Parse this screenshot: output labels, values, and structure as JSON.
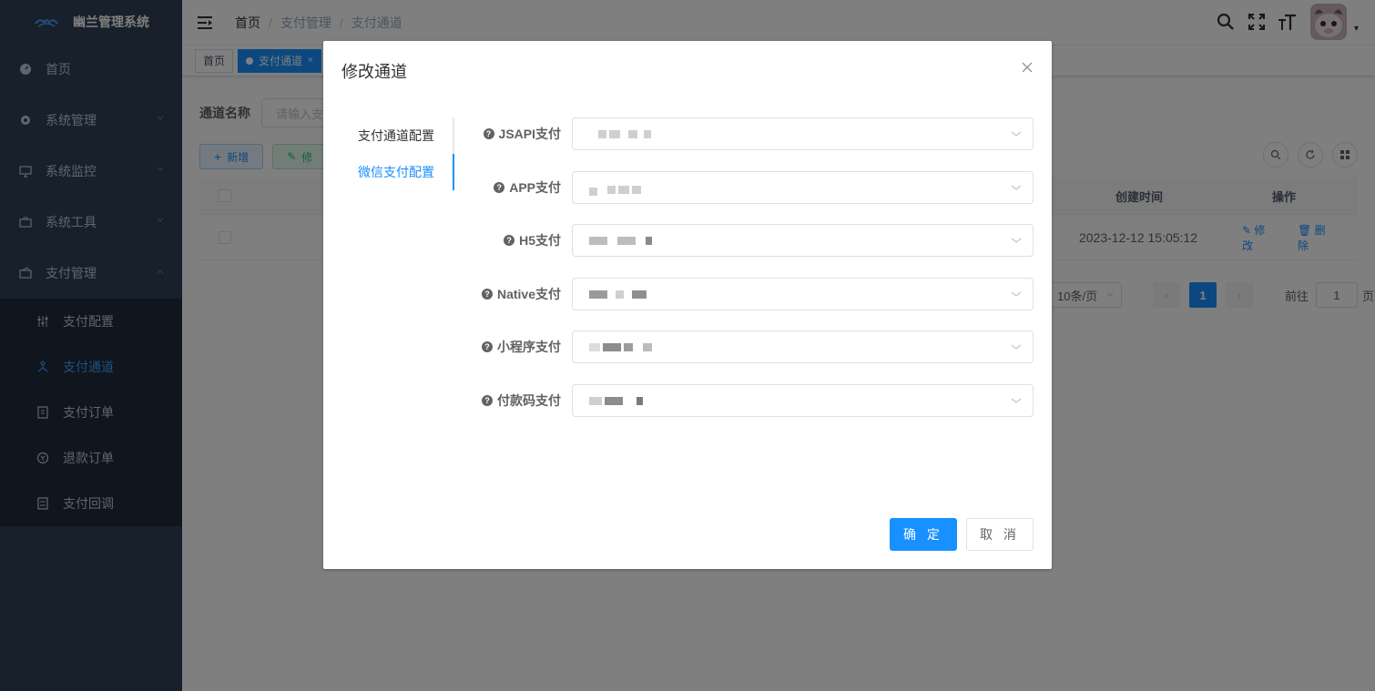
{
  "app": {
    "title": "幽兰管理系统"
  },
  "sidebar": {
    "items": [
      {
        "label": "首页",
        "icon": "dashboard-icon"
      },
      {
        "label": "系统管理",
        "icon": "gear-icon"
      },
      {
        "label": "系统监控",
        "icon": "monitor-icon"
      },
      {
        "label": "系统工具",
        "icon": "toolbox-icon"
      },
      {
        "label": "支付管理",
        "icon": "wallet-icon"
      }
    ],
    "sub_items": [
      {
        "label": "支付配置",
        "icon": "sliders-icon"
      },
      {
        "label": "支付通道",
        "icon": "channel-icon"
      },
      {
        "label": "支付订单",
        "icon": "order-icon"
      },
      {
        "label": "退款订单",
        "icon": "refund-icon"
      },
      {
        "label": "支付回调",
        "icon": "callback-icon"
      }
    ]
  },
  "navbar": {
    "breadcrumb": [
      "首页",
      "支付管理",
      "支付通道"
    ]
  },
  "tags": {
    "home": "首页",
    "current": "支付通道"
  },
  "search": {
    "label": "通道名称",
    "placeholder": "请输入支"
  },
  "toolbar": {
    "add_label": "新增",
    "edit_label": "修"
  },
  "table": {
    "headers": {
      "created": "创建时间",
      "ops": "操作"
    },
    "rows": [
      {
        "created": "2023-12-12 15:05:12",
        "edit": "修改",
        "delete": "删除"
      }
    ]
  },
  "pagination": {
    "page_size": "10条/页",
    "current_page": "1",
    "goto_label": "前往",
    "goto_value": "1",
    "page_suffix": "页"
  },
  "dialog": {
    "title": "修改通道",
    "tabs": [
      "支付通道配置",
      "微信支付配置"
    ],
    "fields": [
      {
        "label": "JSAPI支付"
      },
      {
        "label": "APP支付"
      },
      {
        "label": "H5支付"
      },
      {
        "label": "Native支付"
      },
      {
        "label": "小程序支付"
      },
      {
        "label": "付款码支付"
      }
    ],
    "confirm_label": "确 定",
    "cancel_label": "取 消"
  },
  "colors": {
    "primary": "#1890ff",
    "sidebar_bg": "#304156",
    "sidebar_sub_bg": "#1f2d3d"
  }
}
